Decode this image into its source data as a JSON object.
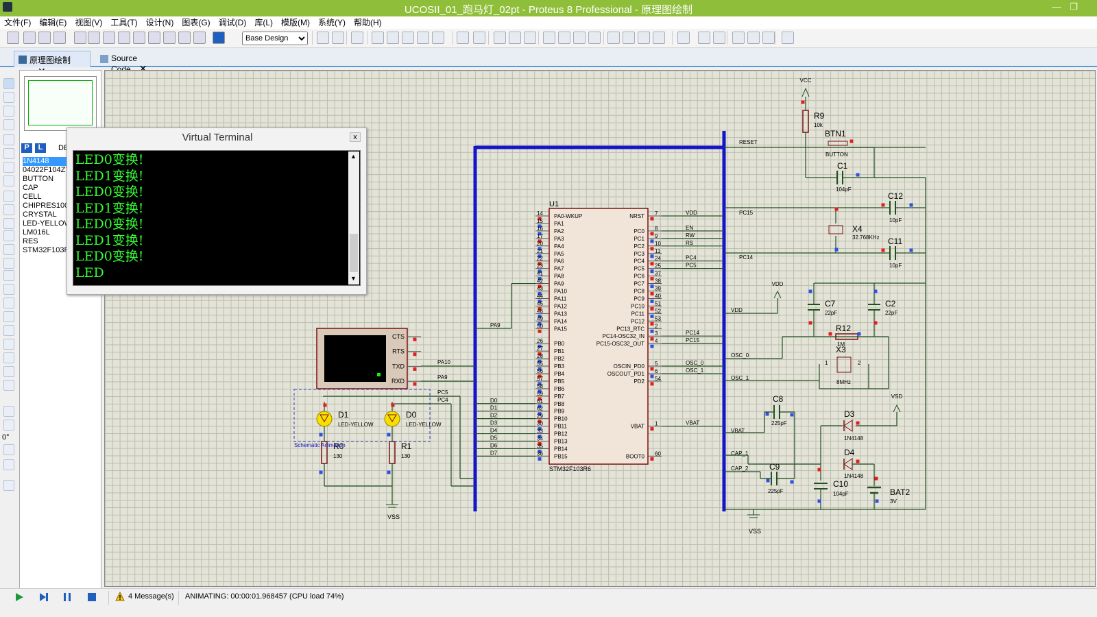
{
  "window": {
    "title": "UCOSII_01_跑马灯_02pt - Proteus 8 Professional - 原理图绘制",
    "minimize": "—",
    "restore": "❐",
    "close": "✕"
  },
  "menu": [
    "文件(F)",
    "编辑(E)",
    "视图(V)",
    "工具(T)",
    "设计(N)",
    "图表(G)",
    "调试(D)",
    "库(L)",
    "模版(M)",
    "系统(Y)",
    "帮助(H)"
  ],
  "toolbar": {
    "design_select": "Base Design"
  },
  "tabs": [
    {
      "label": "原理图绘制",
      "active": true
    },
    {
      "label": "Source Code",
      "active": false
    }
  ],
  "left_panel": {
    "pick_p": "P",
    "pick_l": "L",
    "header_partial": "DE",
    "devices": [
      "1N4148",
      "04022F104Z7",
      "BUTTON",
      "CAP",
      "CELL",
      "CHIPRES100",
      "CRYSTAL",
      "LED-YELLOW",
      "LM016L",
      "RES",
      "STM32F103R6"
    ],
    "selected_index": 0,
    "rotation": "0°"
  },
  "virtual_terminal": {
    "title": "Virtual Terminal",
    "close": "x",
    "lines": [
      "LED0变换!",
      "LED1变换!",
      "LED0变换!",
      "LED1变换!",
      "LED0变换!",
      "LED1变换!",
      "LED0变换!",
      "LED"
    ]
  },
  "status": {
    "messages": "4 Message(s)",
    "animating": "ANIMATING: 00:00:01.968457 (CPU load 74%)"
  },
  "schematic": {
    "u1": {
      "ref": "U1",
      "part": "STM32F103R6",
      "left_pins": [
        [
          "14",
          "PA0-WKUP"
        ],
        [
          "15",
          "PA1"
        ],
        [
          "16",
          "PA2"
        ],
        [
          "17",
          "PA3"
        ],
        [
          "20",
          "PA4"
        ],
        [
          "21",
          "PA5"
        ],
        [
          "22",
          "PA6"
        ],
        [
          "23",
          "PA7"
        ],
        [
          "41",
          "PA8"
        ],
        [
          "42",
          "PA9"
        ],
        [
          "43",
          "PA10"
        ],
        [
          "44",
          "PA11"
        ],
        [
          "45",
          "PA12"
        ],
        [
          "46",
          "PA13"
        ],
        [
          "49",
          "PA14"
        ],
        [
          "50",
          "PA15"
        ],
        [
          "",
          ""
        ],
        [
          "26",
          "PB0"
        ],
        [
          "27",
          "PB1"
        ],
        [
          "28",
          "PB2"
        ],
        [
          "55",
          "PB3"
        ],
        [
          "56",
          "PB4"
        ],
        [
          "57",
          "PB5"
        ],
        [
          "58",
          "PB6"
        ],
        [
          "59",
          "PB7"
        ],
        [
          "61",
          "PB8"
        ],
        [
          "62",
          "PB9"
        ],
        [
          "29",
          "PB10"
        ],
        [
          "30",
          "PB11"
        ],
        [
          "33",
          "PB12"
        ],
        [
          "34",
          "PB13"
        ],
        [
          "35",
          "PB14"
        ],
        [
          "36",
          "PB15"
        ]
      ],
      "right_pins": [
        [
          "7",
          "NRST"
        ],
        [
          "",
          ""
        ],
        [
          "8",
          "PC0"
        ],
        [
          "9",
          "PC1"
        ],
        [
          "10",
          "PC2"
        ],
        [
          "11",
          "PC3"
        ],
        [
          "24",
          "PC4"
        ],
        [
          "25",
          "PC5"
        ],
        [
          "37",
          "PC6"
        ],
        [
          "38",
          "PC7"
        ],
        [
          "39",
          "PC8"
        ],
        [
          "40",
          "PC9"
        ],
        [
          "51",
          "PC10"
        ],
        [
          "52",
          "PC11"
        ],
        [
          "53",
          "PC12"
        ],
        [
          "2",
          "PC13_RTC"
        ],
        [
          "3",
          "PC14-OSC32_IN"
        ],
        [
          "4",
          "PC15-OSC32_OUT"
        ],
        [
          "",
          ""
        ],
        [
          "",
          ""
        ],
        [
          "5",
          "OSCIN_PD0"
        ],
        [
          "6",
          "OSCOUT_PD1"
        ],
        [
          "54",
          "PD2"
        ],
        [
          "",
          ""
        ],
        [
          "",
          ""
        ],
        [
          "",
          ""
        ],
        [
          "",
          ""
        ],
        [
          "",
          ""
        ],
        [
          "1",
          "VBAT"
        ],
        [
          "",
          ""
        ],
        [
          "",
          ""
        ],
        [
          "",
          ""
        ],
        [
          "60",
          "BOOT0"
        ]
      ]
    },
    "net_labels_right": [
      [
        "VDD",
        0
      ],
      [
        "EN",
        2
      ],
      [
        "RW",
        3
      ],
      [
        "RS",
        4
      ],
      [
        "PC4",
        6
      ],
      [
        "PC5",
        7
      ],
      [
        "PC14",
        16
      ],
      [
        "PC15",
        17
      ],
      [
        "OSC_0",
        20
      ],
      [
        "OSC_1",
        21
      ],
      [
        "VBAT",
        28
      ]
    ],
    "data_labels": [
      "D0",
      "D1",
      "D2",
      "D3",
      "D4",
      "D5",
      "D6",
      "D7"
    ],
    "bus_labels": [
      "RESET",
      "PC15",
      "PC14",
      "VDD",
      "OSC_0",
      "OSC_1",
      "VBAT",
      "CAP_1",
      "CAP_2"
    ],
    "pa_labels": {
      "pa9": "PA9",
      "pa10": "PA10",
      "pc5": "PC5",
      "pc4": "PC4"
    },
    "terminal": {
      "pins": [
        "CTS",
        "RTS",
        "TXD",
        "RXD"
      ]
    },
    "leds": [
      {
        "ref": "D1",
        "val": "LED-YELLOW"
      },
      {
        "ref": "D0",
        "val": "LED-YELLOW"
      }
    ],
    "resistors": [
      {
        "ref": "R0",
        "val": "130"
      },
      {
        "ref": "R1",
        "val": "130"
      }
    ],
    "annotation": "Schematic Animation",
    "vss": "VSS",
    "vcc": "VCC",
    "vdd": "VDD",
    "vsd": "VSD",
    "r9": {
      "ref": "R9",
      "val": "10k"
    },
    "btn1": {
      "ref": "BTN1",
      "val": "BUTTON"
    },
    "c1": {
      "ref": "C1",
      "val": "104pF"
    },
    "c12": {
      "ref": "C12",
      "val": "10pF"
    },
    "x4": {
      "ref": "X4",
      "val": "32.768KHz"
    },
    "c11": {
      "ref": "C11",
      "val": "10pF"
    },
    "c7": {
      "ref": "C7",
      "val": "22pF"
    },
    "c2": {
      "ref": "C2",
      "val": "22pF"
    },
    "r12": {
      "ref": "R12",
      "val": "1M"
    },
    "x3": {
      "ref": "X3",
      "val": "8MHz"
    },
    "c8": {
      "ref": "C8",
      "val": "225pF"
    },
    "c9": {
      "ref": "C9",
      "val": "225pF"
    },
    "d3": {
      "ref": "D3",
      "val": "1N4148"
    },
    "d4": {
      "ref": "D4",
      "val": "1N4148"
    },
    "c10": {
      "ref": "C10",
      "val": "104pF"
    },
    "bat2": {
      "ref": "BAT2",
      "val": "3V"
    },
    "x3_pins": [
      "1",
      "2"
    ]
  }
}
